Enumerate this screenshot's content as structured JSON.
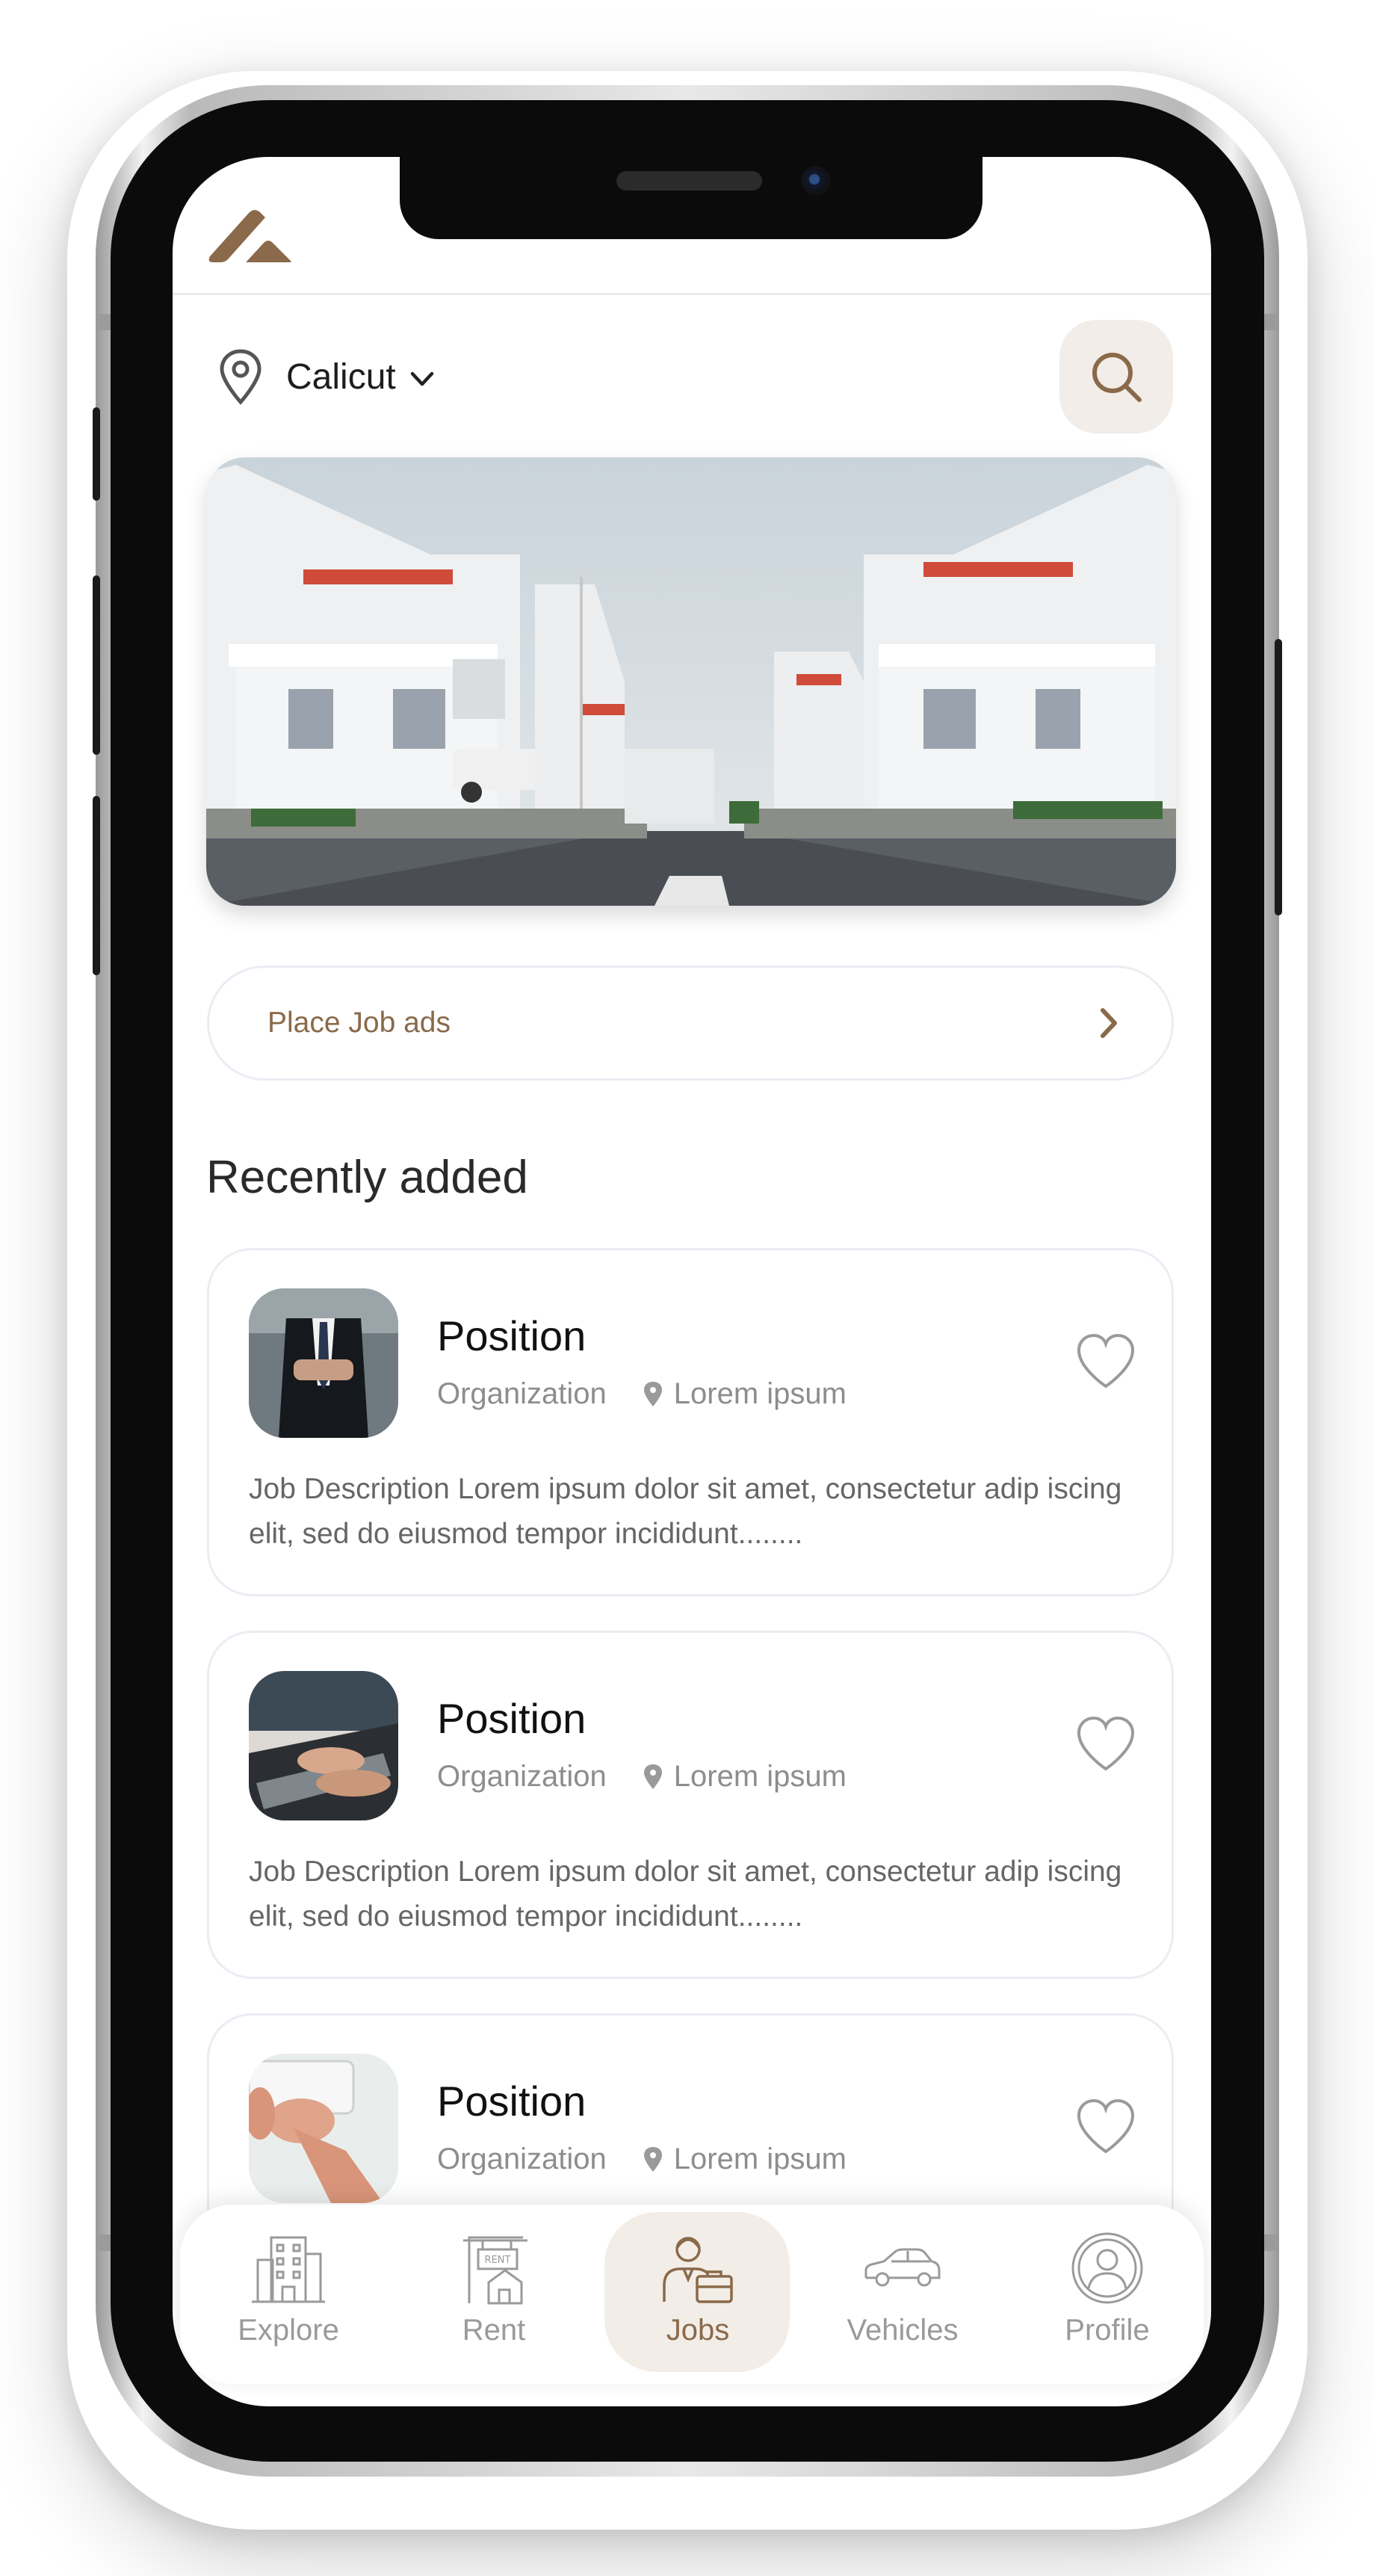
{
  "location": {
    "city": "Calicut"
  },
  "icons": {
    "logo": "brand-logo",
    "location": "map-pin-icon",
    "dropdown": "chevron-down-icon",
    "search": "search-icon",
    "arrow": "chevron-right-icon",
    "favorite": "heart-icon"
  },
  "banner": {
    "image": "housing-street-photo"
  },
  "cta": {
    "label": "Place Job ads"
  },
  "section": {
    "title": "Recently added"
  },
  "jobs": [
    {
      "title": "Position",
      "organization": "Organization",
      "location": "Lorem ipsum",
      "description": "Job Description Lorem ipsum dolor sit amet, consectetur adip iscing elit, sed do eiusmod tempor incididunt........",
      "thumb": "businessman-suit"
    },
    {
      "title": "Position",
      "organization": "Organization",
      "location": "Lorem ipsum",
      "description": "Job Description Lorem ipsum dolor sit amet, consectetur adip iscing elit, sed do eiusmod tempor incididunt........",
      "thumb": "hands-laptop"
    },
    {
      "title": "Position",
      "organization": "Organization",
      "location": "Lorem ipsum",
      "description": "",
      "thumb": "hands-keyboard"
    }
  ],
  "tabs": [
    {
      "label": "Explore",
      "icon": "building-icon",
      "active": false
    },
    {
      "label": "Rent",
      "icon": "rent-sign-icon",
      "active": false
    },
    {
      "label": "Jobs",
      "icon": "jobs-person-briefcase-icon",
      "active": true
    },
    {
      "label": "Vehicles",
      "icon": "car-icon",
      "active": false
    },
    {
      "label": "Profile",
      "icon": "profile-icon",
      "active": false
    }
  ],
  "colors": {
    "accent": "#8a6a4a",
    "accent_bg": "#f3ede7",
    "text_dark": "#1d1d1d",
    "muted": "#8d8d8d",
    "border": "#ececf4"
  }
}
